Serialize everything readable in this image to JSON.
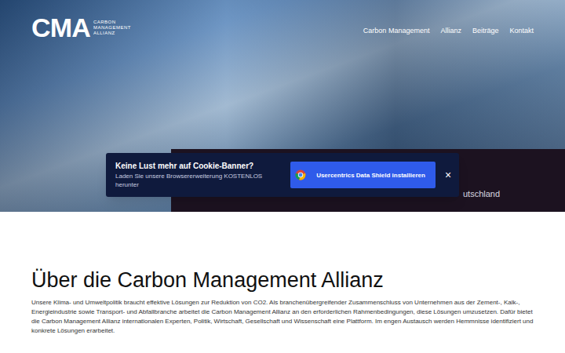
{
  "logo": {
    "mark": "CMA",
    "lines": [
      "CARBON",
      "MANAGEMENT",
      "ALLIANZ"
    ]
  },
  "nav": [
    {
      "label": "Carbon Management"
    },
    {
      "label": "Allianz"
    },
    {
      "label": "Beiträge"
    },
    {
      "label": "Kontakt"
    }
  ],
  "hero_band": {
    "text": "utschland"
  },
  "cookie_banner": {
    "title": "Keine Lust mehr auf Cookie-Banner?",
    "text": "Laden Sie unsere Browsererweiterung KOSTENLOS herunter",
    "button": "Usercentrics Data Shield installieren",
    "close": "×"
  },
  "about": {
    "heading": "Über die Carbon Management Allianz",
    "paragraph": "Unsere Klima- und Umweltpolitik braucht effektive Lösungen zur Reduktion von CO2. Als branchenübergreifender Zusammenschluss von Unternehmen aus der Zement-, Kalk-, Energieindustrie sowie Transport- und Abfallbranche arbeitet die Carbon Management Allianz an den erforderlichen Rahmenbedingungen, diese Lösungen umzusetzen. Dafür bietet die Carbon Management Allianz internationalen Experten, Politik, Wirtschaft, Gesellschaft und Wissenschaft eine Plattform. Im engen Austausch werden Hemmnisse identifiziert und konkrete Lösungen erarbeitet."
  }
}
